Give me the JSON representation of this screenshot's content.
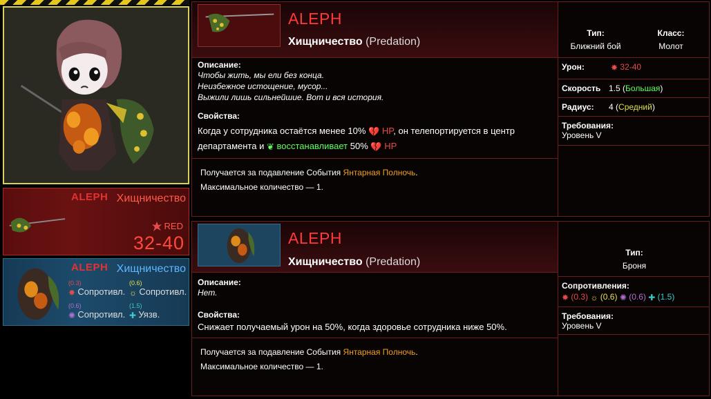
{
  "colors": {
    "red": "#e64b4b",
    "green": "#5cff5c",
    "orange": "#f0a020",
    "risk": "#ff3a3a"
  },
  "mini_weapon": {
    "rank": "ALEPH",
    "name": "Хищничество",
    "damage_type": "RED",
    "damage": "32-40"
  },
  "mini_armor": {
    "rank": "ALEPH",
    "name": "Хищничество",
    "resists": [
      {
        "value": "(0.3)",
        "label": "Сопротивл.",
        "icon": "red-damage-icon",
        "color": "#e64b4b"
      },
      {
        "value": "(0.6)",
        "label": "Сопротивл.",
        "icon": "white-damage-icon",
        "color": "#e8e050"
      },
      {
        "value": "(0.6)",
        "label": "Сопротивл.",
        "icon": "black-damage-icon",
        "color": "#b070d0"
      },
      {
        "value": "(1.5)",
        "label": "Уязв.",
        "icon": "pale-damage-icon",
        "color": "#40c8c8"
      }
    ]
  },
  "weapon": {
    "rank": "ALEPH",
    "title": "Хищничество",
    "title_orig": "(Predation)",
    "desc_label": "Описание:",
    "desc_lines": [
      "Чтобы жить, мы ели без конца.",
      "Неизбежное истощение, мусор...",
      "Выжили лишь сильнейшие. Вот и вся история."
    ],
    "props_label": "Свойства:",
    "props_1": "Когда у сотрудника остаётся менее 10%",
    "hp": "HP",
    "props_2": ", он телепортируется в центр",
    "props_3": "департамента и",
    "restores": "восстанавливает",
    "props_4": "50%",
    "obtain_1": "Получается за подавление События",
    "event": "Янтарная Полночь",
    "obtain_end": ".",
    "max_count": "Максимальное количество — 1.",
    "type_label": "Тип:",
    "type_value": "Ближний бой",
    "class_label": "Класс:",
    "class_value": "Молот",
    "damage_label": "Урон:",
    "damage_value": "32-40",
    "speed_label": "Скорость",
    "speed_value": "1.5",
    "speed_note": "Большая",
    "radius_label": "Радиус:",
    "radius_value": "4",
    "radius_note": "Средний",
    "req_label": "Требования:",
    "req_value": "Уровень V"
  },
  "armor": {
    "rank": "ALEPH",
    "title": "Хищничество",
    "title_orig": "(Predation)",
    "desc_label": "Описание:",
    "desc_value": "Нет.",
    "props_label": "Свойства:",
    "props_value": "Снижает получаемый урон на 50%, когда здоровье сотрудника ниже 50%.",
    "obtain_1": "Получается за подавление События",
    "event": "Янтарная Полночь",
    "obtain_end": ".",
    "max_count": "Максимальное количество — 1.",
    "type_label": "Тип:",
    "type_value": "Броня",
    "res_label": "Сопротивления:",
    "res": [
      "(0.3)",
      "(0.6)",
      "(0.6)",
      "(1.5)"
    ],
    "req_label": "Требования:",
    "req_value": "Уровень V"
  }
}
